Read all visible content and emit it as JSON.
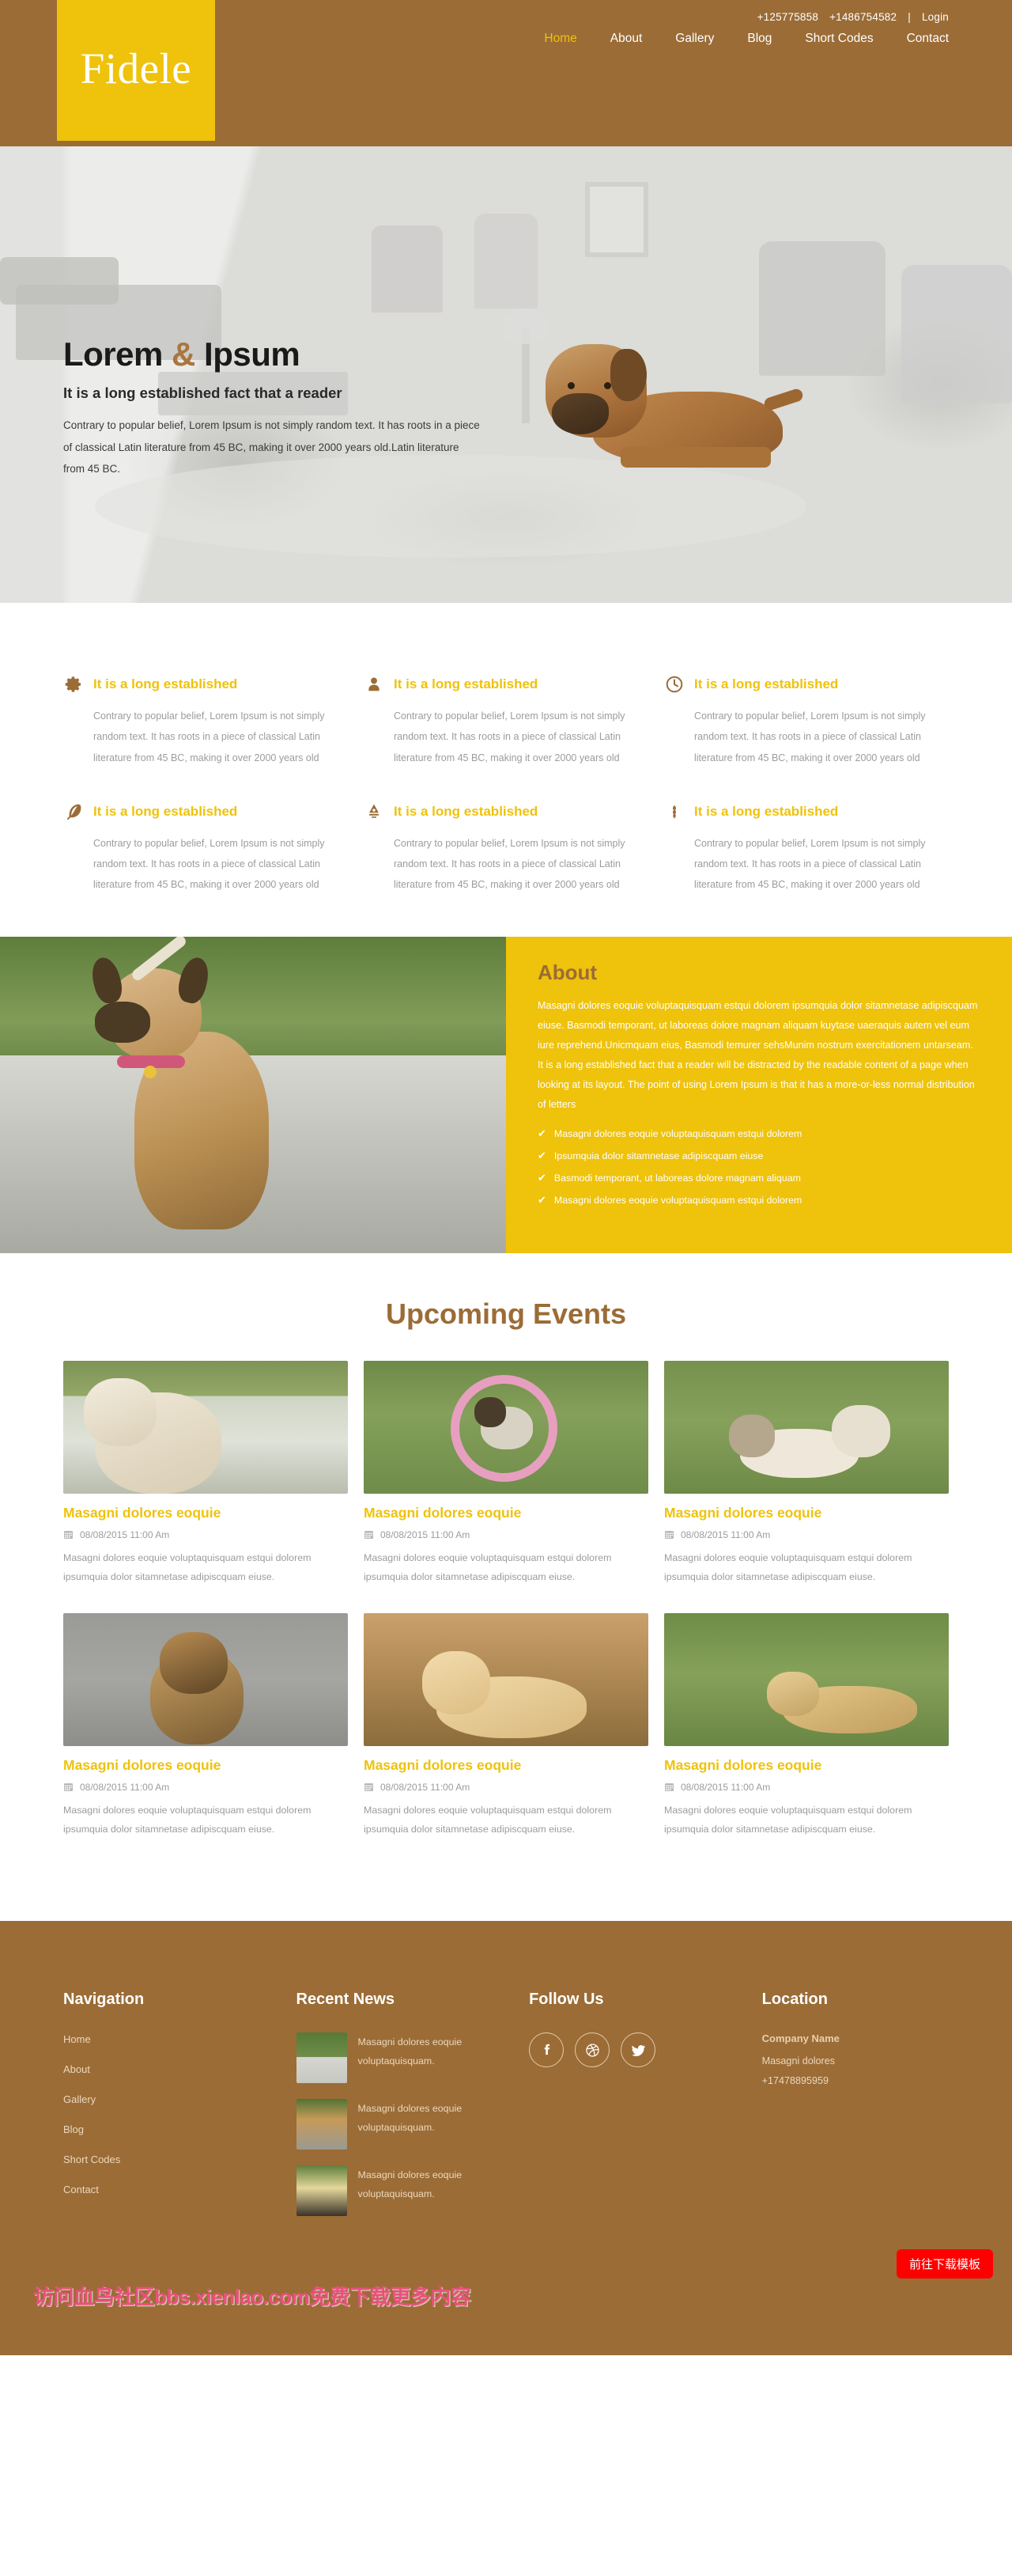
{
  "header": {
    "logo": "Fidele",
    "phone1": "+125775858",
    "phone2": "+1486754582",
    "separator": "|",
    "login": "Login",
    "nav": [
      {
        "label": "Home",
        "active": true
      },
      {
        "label": "About",
        "active": false
      },
      {
        "label": "Gallery",
        "active": false
      },
      {
        "label": "Blog",
        "active": false
      },
      {
        "label": "Short Codes",
        "active": false
      },
      {
        "label": "Contact",
        "active": false
      }
    ]
  },
  "hero": {
    "title_left": "Lorem",
    "title_amp": "&",
    "title_right": "Ipsum",
    "subtitle": "It is a long established fact that a reader",
    "description": "Contrary to popular belief, Lorem Ipsum is not simply random text. It has roots in a piece of classical Latin literature from 45 BC, making it over 2000 years old.Latin literature from 45 BC."
  },
  "features": [
    {
      "icon": "gear-icon",
      "title": "It is a long established",
      "text": "Contrary to popular belief, Lorem Ipsum is not simply random text. It has roots in a piece of classical Latin literature from 45 BC, making it over 2000 years old"
    },
    {
      "icon": "user-icon",
      "title": "It is a long established",
      "text": "Contrary to popular belief, Lorem Ipsum is not simply random text. It has roots in a piece of classical Latin literature from 45 BC, making it over 2000 years old"
    },
    {
      "icon": "clock-icon",
      "title": "It is a long established",
      "text": "Contrary to popular belief, Lorem Ipsum is not simply random text. It has roots in a piece of classical Latin literature from 45 BC, making it over 2000 years old"
    },
    {
      "icon": "feather-icon",
      "title": "It is a long established",
      "text": "Contrary to popular belief, Lorem Ipsum is not simply random text. It has roots in a piece of classical Latin literature from 45 BC, making it over 2000 years old"
    },
    {
      "icon": "pen-nib-icon",
      "title": "It is a long established",
      "text": "Contrary to popular belief, Lorem Ipsum is not simply random text. It has roots in a piece of classical Latin literature from 45 BC, making it over 2000 years old"
    },
    {
      "icon": "wheat-icon",
      "title": "It is a long established",
      "text": "Contrary to popular belief, Lorem Ipsum is not simply random text. It has roots in a piece of classical Latin literature from 45 BC, making it over 2000 years old"
    }
  ],
  "about": {
    "title": "About",
    "text": "Masagni dolores eoquie voluptaquisquam estqui dolorem ipsumquia dolor sitamnetase adipiscquam eiuse. Basmodi temporant, ut laboreas dolore magnam aliquam kuytase uaeraquis autem vel eum iure reprehend.Unicmquam eius, Basmodi temurer sehsMunim nostrum exercitationem untarseam. It is a long established fact that a reader will be distracted by the readable content of a page when looking at its layout. The point of using Lorem Ipsum is that it has a more-or-less normal distribution of letters",
    "bullets": [
      "Masagni dolores eoquie voluptaquisquam estqui dolorem",
      "Ipsumquia dolor sitamnetase adipiscquam eiuse",
      "Basmodi temporant, ut laboreas dolore magnam aliquam",
      "Masagni dolores eoquie voluptaquisquam estqui dolorem"
    ]
  },
  "events": {
    "title": "Upcoming Events",
    "items": [
      {
        "title": "Masagni dolores eoquie",
        "date": "08/08/2015 11:00 Am",
        "desc": "Masagni dolores eoquie voluptaquisquam estqui dolorem ipsumquia dolor sitamnetase adipiscquam eiuse."
      },
      {
        "title": "Masagni dolores eoquie",
        "date": "08/08/2015 11:00 Am",
        "desc": "Masagni dolores eoquie voluptaquisquam estqui dolorem ipsumquia dolor sitamnetase adipiscquam eiuse."
      },
      {
        "title": "Masagni dolores eoquie",
        "date": "08/08/2015 11:00 Am",
        "desc": "Masagni dolores eoquie voluptaquisquam estqui dolorem ipsumquia dolor sitamnetase adipiscquam eiuse."
      },
      {
        "title": "Masagni dolores eoquie",
        "date": "08/08/2015 11:00 Am",
        "desc": "Masagni dolores eoquie voluptaquisquam estqui dolorem ipsumquia dolor sitamnetase adipiscquam eiuse."
      },
      {
        "title": "Masagni dolores eoquie",
        "date": "08/08/2015 11:00 Am",
        "desc": "Masagni dolores eoquie voluptaquisquam estqui dolorem ipsumquia dolor sitamnetase adipiscquam eiuse."
      },
      {
        "title": "Masagni dolores eoquie",
        "date": "08/08/2015 11:00 Am",
        "desc": "Masagni dolores eoquie voluptaquisquam estqui dolorem ipsumquia dolor sitamnetase adipiscquam eiuse."
      }
    ]
  },
  "footer": {
    "navigation": {
      "heading": "Navigation",
      "items": [
        "Home",
        "About",
        "Gallery",
        "Blog",
        "Short Codes",
        "Contact"
      ]
    },
    "recent_news": {
      "heading": "Recent News",
      "items": [
        {
          "text": "Masagni dolores eoquie voluptaquisquam."
        },
        {
          "text": "Masagni dolores eoquie voluptaquisquam."
        },
        {
          "text": "Masagni dolores eoquie voluptaquisquam."
        }
      ]
    },
    "follow": {
      "heading": "Follow Us",
      "socials": [
        "facebook-icon",
        "dribbble-icon",
        "twitter-icon"
      ]
    },
    "location": {
      "heading": "Location",
      "company": "Company Name",
      "address": "Masagni dolores",
      "phone": "+17478895959"
    }
  },
  "overlay": {
    "download_button": "前往下载模板",
    "watermark": "访问血鸟社区bbs.xienlao.com免费下载更多内容"
  },
  "colors": {
    "brand_brown": "#9b6c36",
    "brand_yellow": "#efc20b",
    "muted_text": "#9c9c9c",
    "download_red": "#ff0000"
  }
}
